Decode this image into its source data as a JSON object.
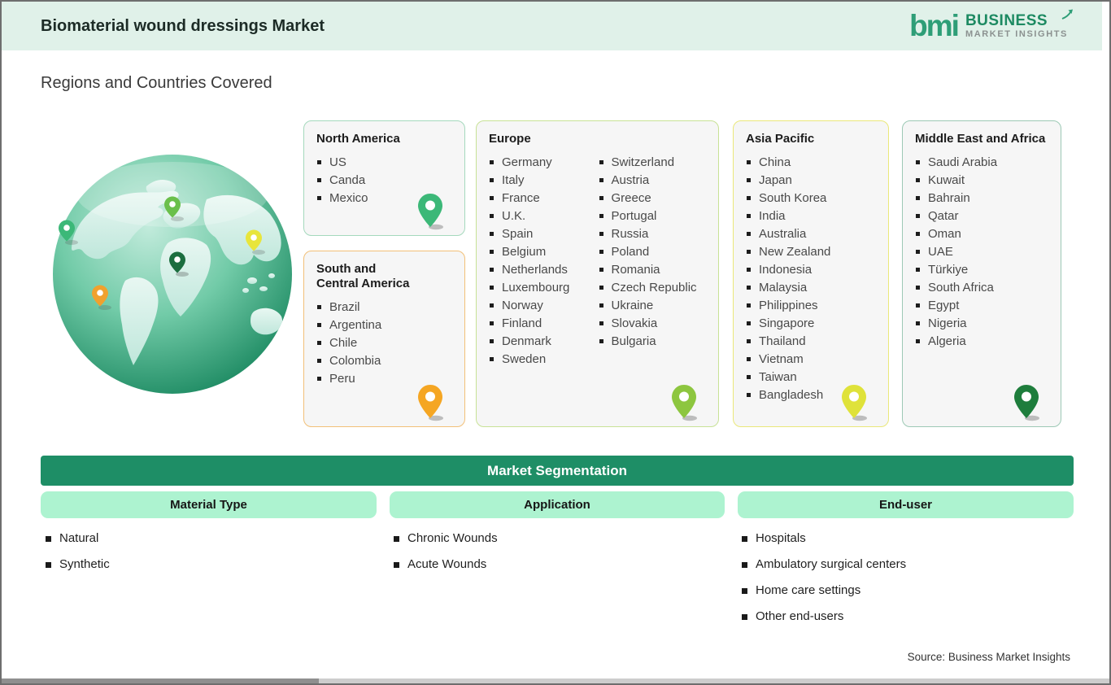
{
  "page": {
    "title": "Biomaterial wound dressings Market",
    "section_title": "Regions and Countries Covered",
    "source_note": "Source: Business Market Insights"
  },
  "logo": {
    "mark": "bmi",
    "line1": "BUSINESS",
    "line2": "MARKET INSIGHTS"
  },
  "colors": {
    "header_bg": "#e0f1e9",
    "brand_green": "#1d8a62",
    "banner_green": "#1e8e66",
    "pill_mint": "#adf3d0",
    "card_bg": "#f6f6f6"
  },
  "icons": {
    "map_pin": "map-pin",
    "list_bullet": "square-bullet",
    "logo_arrow": "arrow-up-right"
  },
  "regions": [
    {
      "name": "North America",
      "border_color": "#a5d9bd",
      "pin_color": "#3cb878",
      "countries": [
        "US",
        "Canda",
        "Mexico"
      ]
    },
    {
      "name": "South and Central America",
      "border_color": "#f2c078",
      "pin_color": "#f5a623",
      "countries": [
        "Brazil",
        "Argentina",
        "Chile",
        "Colombia",
        "Peru"
      ]
    },
    {
      "name": "Europe",
      "border_color": "#c8e296",
      "pin_color": "#8dc63f",
      "countries": [
        "Germany",
        "Italy",
        "France",
        "U.K.",
        "Spain",
        "Belgium",
        "Netherlands",
        "Luxembourg",
        "Norway",
        "Finland",
        "Denmark",
        "Sweden",
        "Switzerland",
        "Austria",
        "Greece",
        "Portugal",
        "Russia",
        "Poland",
        "Romania",
        "Czech Republic",
        "Ukraine",
        "Slovakia",
        "Bulgaria"
      ]
    },
    {
      "name": "Asia Pacific",
      "border_color": "#eae87a",
      "pin_color": "#dfe23a",
      "countries": [
        "China",
        "Japan",
        "South Korea",
        "India",
        "Australia",
        "New Zealand",
        "Indonesia",
        "Malaysia",
        "Philippines",
        "Singapore",
        "Thailand",
        "Vietnam",
        "Taiwan",
        "Bangladesh"
      ]
    },
    {
      "name": "Middle East and Africa",
      "border_color": "#9dc9b5",
      "pin_color": "#1e7d3c",
      "countries": [
        "Saudi Arabia",
        "Kuwait",
        "Bahrain",
        "Qatar",
        "Oman",
        "UAE",
        "Türkiye",
        "South Africa",
        "Egypt",
        "Nigeria",
        "Algeria"
      ]
    }
  ],
  "segmentation": {
    "banner": "Market Segmentation",
    "columns": [
      {
        "header": "Material Type",
        "items": [
          "Natural",
          "Synthetic"
        ]
      },
      {
        "header": "Application",
        "items": [
          "Chronic Wounds",
          "Acute Wounds"
        ]
      },
      {
        "header": "End-user",
        "items": [
          "Hospitals",
          "Ambulatory surgical centers",
          "Home care settings",
          "Other end-users"
        ]
      }
    ]
  }
}
